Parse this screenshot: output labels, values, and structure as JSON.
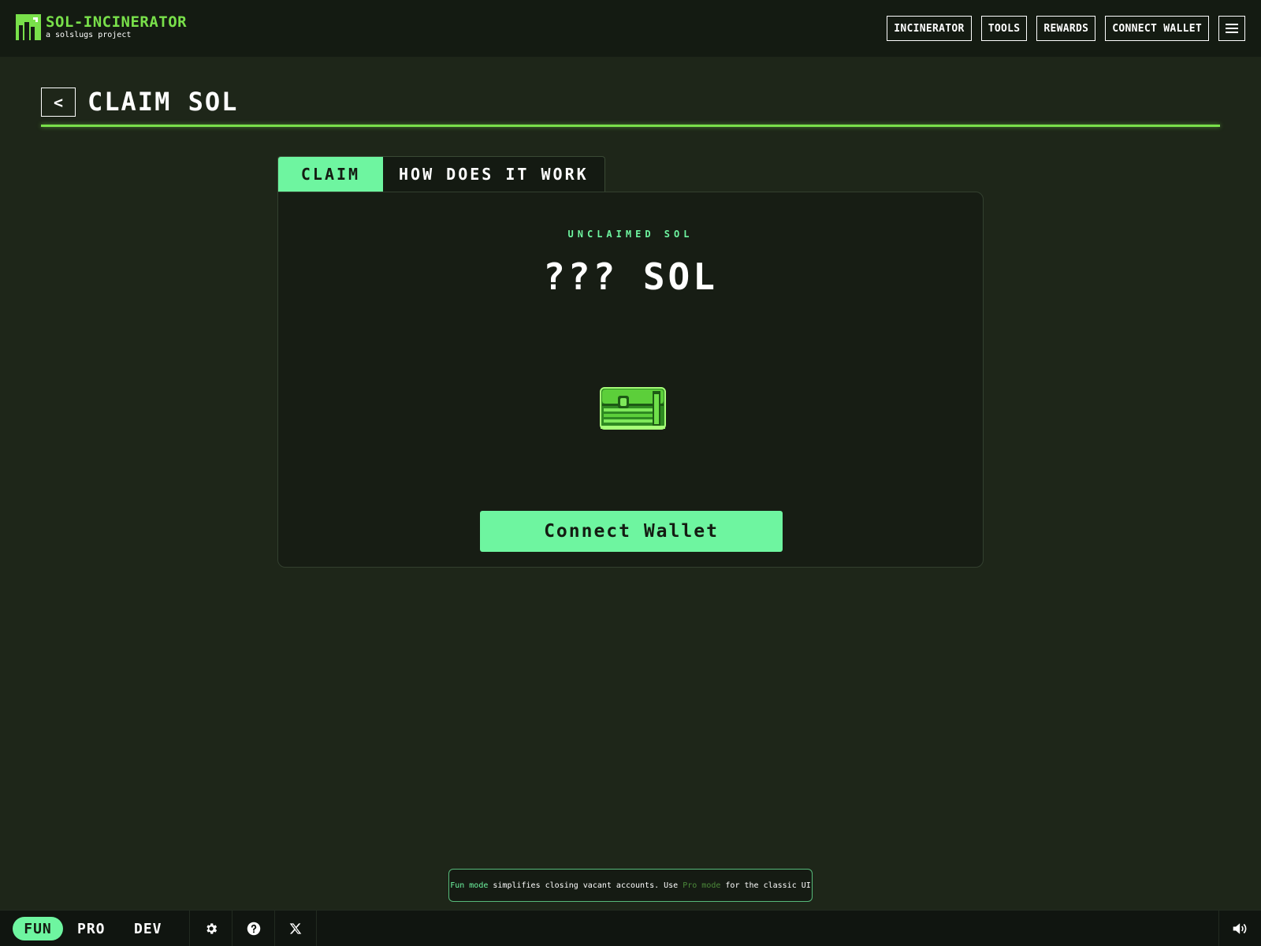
{
  "header": {
    "logo_title": "SOL-INCINERATOR",
    "logo_subtitle": "a solslugs project",
    "nav": [
      {
        "label": "INCINERATOR"
      },
      {
        "label": "TOOLS"
      },
      {
        "label": "REWARDS"
      },
      {
        "label": "CONNECT WALLET"
      }
    ],
    "menu_icon": "hamburger-icon"
  },
  "page": {
    "back_icon": "chevron-left-icon",
    "back_glyph": "<",
    "title": "CLAIM SOL"
  },
  "tabs": [
    {
      "label": "CLAIM",
      "active": true
    },
    {
      "label": "HOW DOES IT WORK",
      "active": false
    }
  ],
  "claim": {
    "label": "UNCLAIMED SOL",
    "amount": "??? SOL",
    "chest_icon": "treasure-chest-icon",
    "connect_label": "Connect Wallet"
  },
  "toast": {
    "fun": "Fun mode",
    "mid": " simplifies closing vacant accounts. Use ",
    "pro": "Pro mode",
    "end": " for the classic UI"
  },
  "footer": {
    "modes": [
      "FUN",
      "PRO",
      "DEV"
    ],
    "active_mode": "FUN",
    "icons": [
      "gear-icon",
      "help-icon",
      "x-logo-icon",
      "speaker-icon"
    ]
  },
  "colors": {
    "accent": "#6ef5a0",
    "brand_green": "#79e04a",
    "background": "#1e2619",
    "header_bg": "#141b12"
  }
}
